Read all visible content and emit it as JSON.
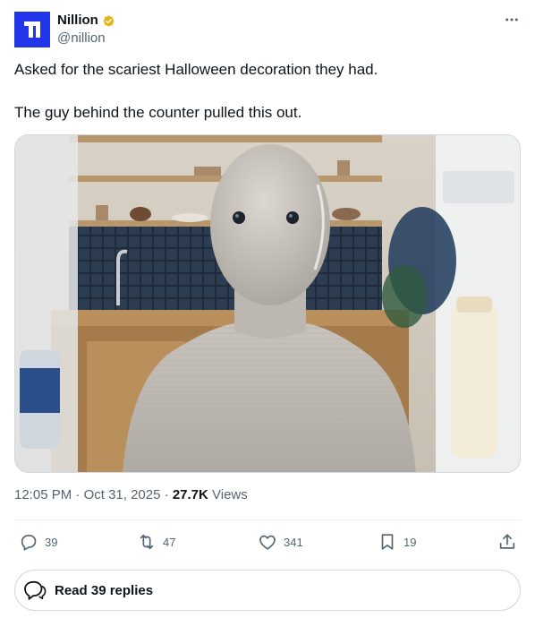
{
  "author": {
    "display_name": "Nillion",
    "handle": "@nillion",
    "verified_color": "#e2b719",
    "avatar_color": "#2135ea"
  },
  "tweet": {
    "line1": "Asked for the scariest Halloween decoration they had.",
    "line2": "The guy behind the counter pulled this out."
  },
  "media": {
    "type": "photo"
  },
  "meta": {
    "time": "12:05 PM",
    "sep1": "·",
    "date": "Oct 31, 2025",
    "sep2": "·",
    "views_count": "27.7K",
    "views_label": "Views"
  },
  "actions": {
    "replies": "39",
    "reposts": "47",
    "likes": "341",
    "bookmarks": "19"
  },
  "read_replies": {
    "label": "Read 39 replies"
  },
  "icons": [
    "more-icon",
    "verified-icon",
    "reply-icon",
    "repost-icon",
    "like-icon",
    "bookmark-icon",
    "share-icon",
    "read-replies-icon"
  ]
}
